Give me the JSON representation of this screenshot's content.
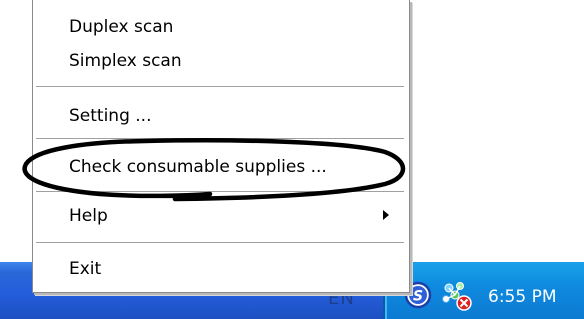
{
  "menu": {
    "items": [
      {
        "label": "Duplex scan"
      },
      {
        "label": "Simplex scan"
      },
      {
        "label": "Setting ..."
      },
      {
        "label": "Check consumable supplies ..."
      },
      {
        "label": "Help",
        "has_submenu": true
      },
      {
        "label": "Exit"
      }
    ]
  },
  "taskbar": {
    "language": "EN",
    "tray_icons": [
      "scanner-s-icon",
      "network-error-icon"
    ],
    "clock": "6:55 PM"
  },
  "colors": {
    "taskbar": "#245edb",
    "tray": "#0f8be0",
    "annotation": "#000000"
  }
}
